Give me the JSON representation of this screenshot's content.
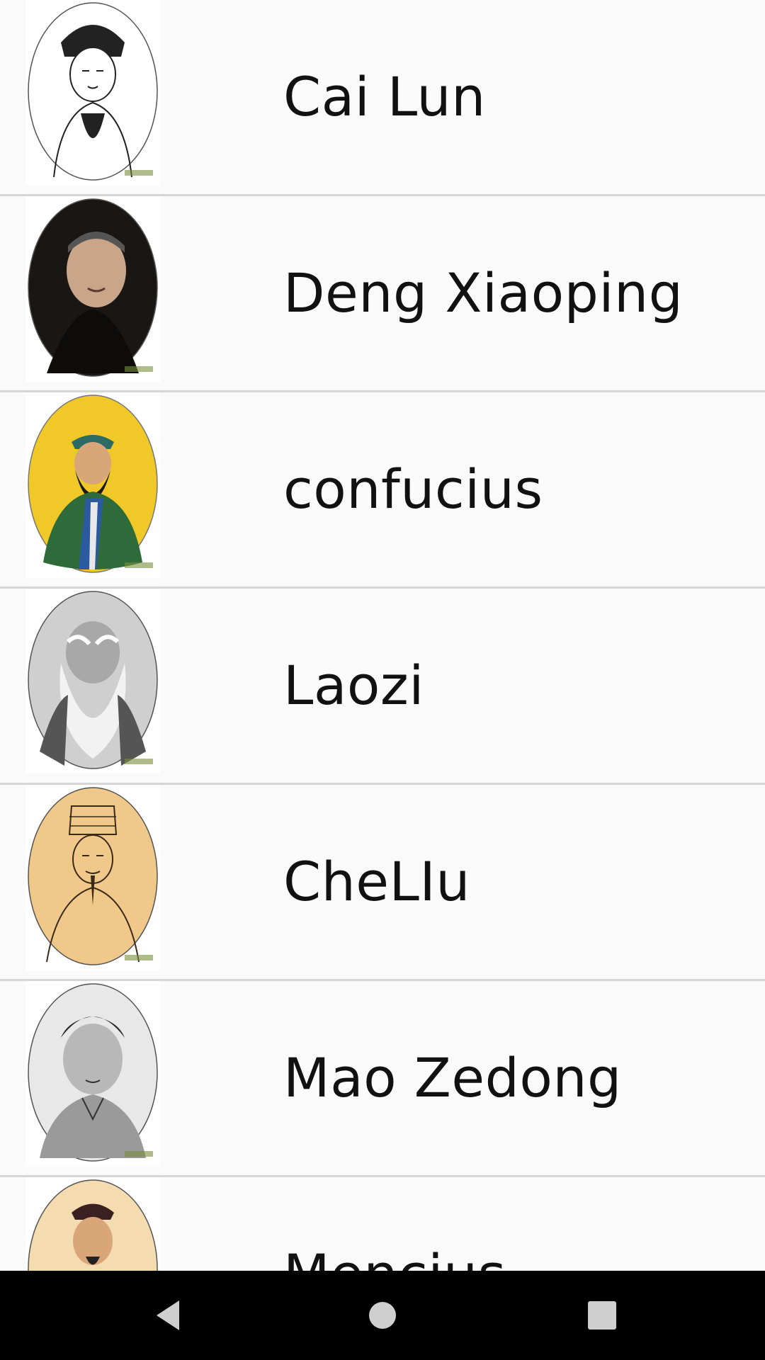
{
  "people": [
    {
      "name": "Cai Lun",
      "portrait_bg": "#ffffff",
      "portrait_tone": "line-art"
    },
    {
      "name": "Deng Xiaoping",
      "portrait_bg": "#1a1614",
      "portrait_tone": "photo"
    },
    {
      "name": "confucius",
      "portrait_bg": "#f0c928",
      "portrait_tone": "painting"
    },
    {
      "name": "Laozi",
      "portrait_bg": "#d8d8d8",
      "portrait_tone": "grayscale"
    },
    {
      "name": "CheLIu",
      "portrait_bg": "#f0c98a",
      "portrait_tone": "line-art"
    },
    {
      "name": "Mao Zedong",
      "portrait_bg": "#e6e6e6",
      "portrait_tone": "grayscale"
    },
    {
      "name": "Mencius",
      "portrait_bg": "#f5dcb0",
      "portrait_tone": "painting"
    }
  ],
  "navbar": {
    "back": "back-icon",
    "home": "home-icon",
    "recents": "recents-icon"
  }
}
